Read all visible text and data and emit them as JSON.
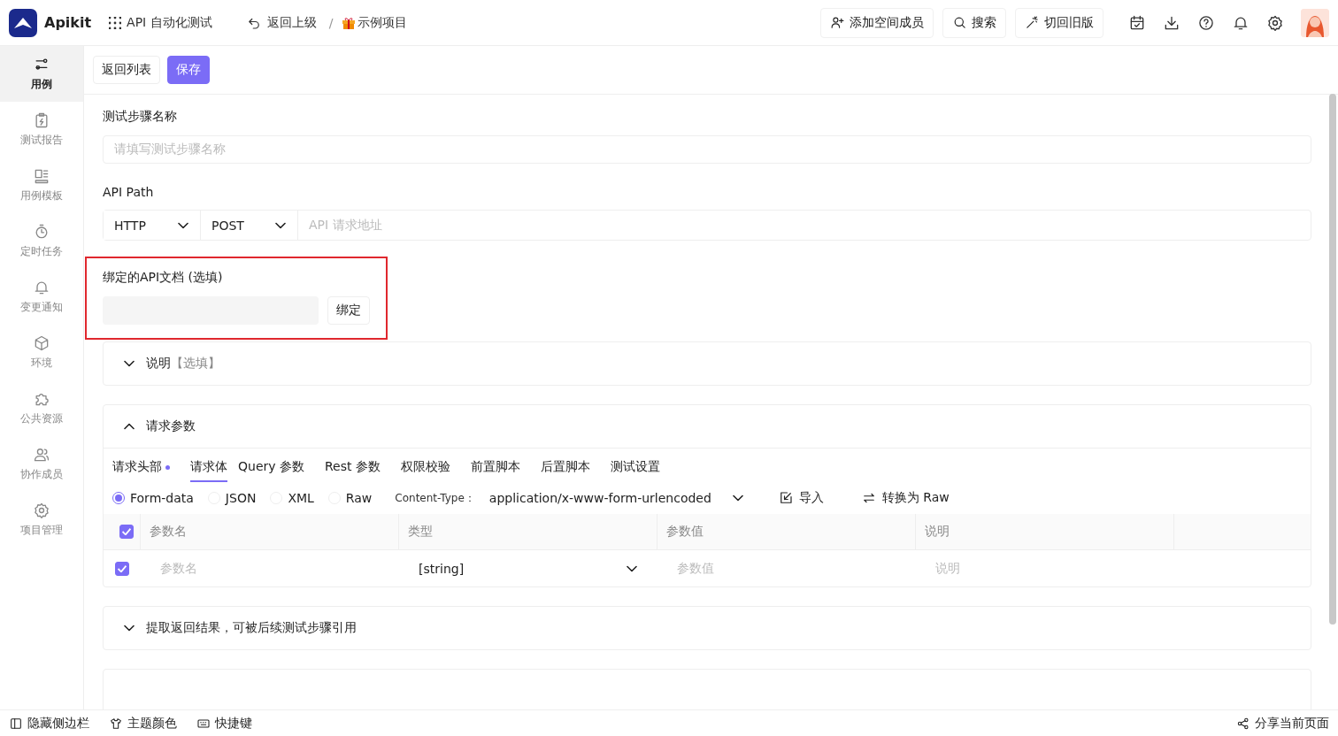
{
  "header": {
    "logo_text": "Apikit",
    "app_menu": "API 自动化测试",
    "back": "返回上级",
    "separator": "/",
    "project": "示例项目",
    "actions": [
      {
        "kind": "add-user",
        "label": "添加空间成员"
      },
      {
        "kind": "search",
        "label": "搜索"
      },
      {
        "kind": "wand",
        "label": "切回旧版"
      }
    ],
    "icon_buttons": [
      {
        "kind": "calendar"
      },
      {
        "kind": "download"
      },
      {
        "kind": "help"
      },
      {
        "kind": "bell"
      },
      {
        "kind": "settings"
      }
    ]
  },
  "sidebar": {
    "items": [
      {
        "kind": "case",
        "label": "用例",
        "selected": true
      },
      {
        "kind": "report",
        "label": "测试报告",
        "selected": false
      },
      {
        "kind": "template",
        "label": "用例模板",
        "selected": false
      },
      {
        "kind": "timer",
        "label": "定时任务",
        "selected": false
      },
      {
        "kind": "bell",
        "label": "变更通知",
        "selected": false
      },
      {
        "kind": "cube",
        "label": "环境",
        "selected": false
      },
      {
        "kind": "puzzle",
        "label": "公共资源",
        "selected": false
      },
      {
        "kind": "users",
        "label": "协作成员",
        "selected": false
      },
      {
        "kind": "settings",
        "label": "项目管理",
        "selected": false
      }
    ]
  },
  "toolbar": [
    {
      "label": "返回列表",
      "kind": "default"
    },
    {
      "label": "保存",
      "kind": "primary"
    }
  ],
  "step_name": {
    "label": "测试步骤名称",
    "placeholder": "请填写测试步骤名称"
  },
  "api_path": {
    "label": "API Path",
    "protocol": "HTTP",
    "method": "POST",
    "placeholder": "API 请求地址"
  },
  "bind_doc": {
    "label": "绑定的API文档 (选填)",
    "button": "绑定",
    "highlighted": true
  },
  "description": {
    "title": "说明",
    "hint": "【选填】",
    "expanded": false
  },
  "request_params": {
    "title": "请求参数",
    "expanded": true,
    "tabs": [
      {
        "label": "请求头部",
        "selected": false,
        "dot": true
      },
      {
        "label": "请求体",
        "selected": true,
        "dot": false
      },
      {
        "label": "Query 参数",
        "selected": false,
        "dot": false
      },
      {
        "label": "Rest 参数",
        "selected": false,
        "dot": false
      },
      {
        "label": "权限校验",
        "selected": false,
        "dot": false
      },
      {
        "label": "前置脚本",
        "selected": false,
        "dot": false
      },
      {
        "label": "后置脚本",
        "selected": false,
        "dot": false
      },
      {
        "label": "测试设置",
        "selected": false,
        "dot": false
      }
    ],
    "body_types": [
      {
        "label": "Form-data",
        "selected": true
      },
      {
        "label": "JSON",
        "selected": false
      },
      {
        "label": "XML",
        "selected": false
      },
      {
        "label": "Raw",
        "selected": false
      }
    ],
    "content_type_label": "Content-Type：",
    "content_type": "application/x-www-form-urlencoded",
    "actions": [
      {
        "kind": "import",
        "label": "导入"
      },
      {
        "kind": "convert",
        "label": "转换为 Raw"
      }
    ],
    "columns": [
      "参数名",
      "类型",
      "参数值",
      "说明"
    ],
    "all_checked": true,
    "rows": [
      {
        "checked": true,
        "name_placeholder": "参数名",
        "type": "[string]",
        "value_placeholder": "参数值",
        "desc_placeholder": "说明"
      }
    ]
  },
  "extract": {
    "title": "提取返回结果，可被后续测试步骤引用",
    "expanded": false
  },
  "footer": {
    "left": [
      {
        "kind": "sidebar",
        "label": "隐藏侧边栏"
      },
      {
        "kind": "shirt",
        "label": "主题颜色"
      },
      {
        "kind": "keyboard",
        "label": "快捷键"
      }
    ],
    "share": {
      "kind": "share",
      "label": "分享当前页面"
    }
  }
}
